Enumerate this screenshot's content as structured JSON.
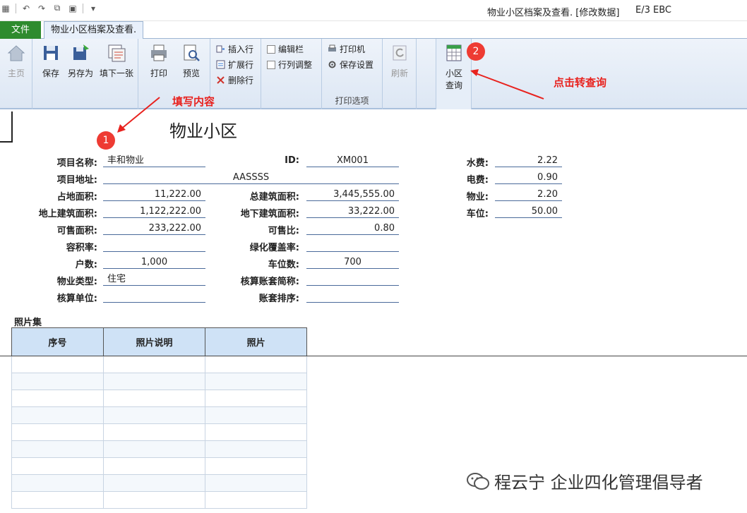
{
  "window": {
    "title": "物业小区档案及查看. [修改数据]",
    "app": "E/3 EBC"
  },
  "tabs": {
    "file": "文件",
    "doc": "物业小区档案及查看."
  },
  "ribbon": {
    "home": "主页",
    "save": "保存",
    "save_as": "另存为",
    "fill_next": "填下一张",
    "print": "打印",
    "preview": "预览",
    "insert_row": "插入行",
    "expand_row": "扩展行",
    "delete_row": "删除行",
    "edit_bar": "编辑栏",
    "row_col_adjust": "行列调整",
    "printer": "打印机",
    "save_settings": "保存设置",
    "print_options": "打印选项",
    "refresh": "刷新",
    "community_query_line1": "小区",
    "community_query_line2": "查询"
  },
  "annotations": {
    "fill_content": "填写内容",
    "badge1": "1",
    "badge2": "2",
    "click_query": "点击转查询"
  },
  "form": {
    "title": "物业小区",
    "fields": {
      "project_name_label": "项目名称:",
      "project_name": "丰和物业",
      "id_label": "ID:",
      "id": "XM001",
      "water_label": "水费:",
      "water": "2.22",
      "address_label": "项目地址:",
      "address": "AASSSS",
      "electric_label": "电费:",
      "electric": "0.90",
      "land_area_label": "占地面积:",
      "land_area": "11,222.00",
      "total_area_label": "总建筑面积:",
      "total_area": "3,445,555.00",
      "property_label": "物业:",
      "property": "2.20",
      "above_area_label": "地上建筑面积:",
      "above_area": "1,122,222.00",
      "under_area_label": "地下建筑面积:",
      "under_area": "33,222.00",
      "parking_fee_label": "车位:",
      "parking_fee": "50.00",
      "sale_area_label": "可售面积:",
      "sale_area": "233,222.00",
      "sale_ratio_label": "可售比:",
      "sale_ratio": "0.80",
      "plot_ratio_label": "容积率:",
      "plot_ratio": "",
      "green_ratio_label": "绿化覆盖率:",
      "green_ratio": "",
      "households_label": "户数:",
      "households": "1,000",
      "parking_count_label": "车位数:",
      "parking_count": "700",
      "type_label": "物业类型:",
      "type": "住宅",
      "account_abbr_label": "核算账套简称:",
      "account_abbr": "",
      "account_unit_label": "核算单位:",
      "account_unit": "",
      "account_order_label": "账套排序:",
      "account_order": ""
    }
  },
  "photos": {
    "label": "照片集",
    "headers": [
      "序号",
      "照片说明",
      "照片"
    ],
    "row_count": 9
  },
  "watermark": "程云宁 企业四化管理倡导者"
}
